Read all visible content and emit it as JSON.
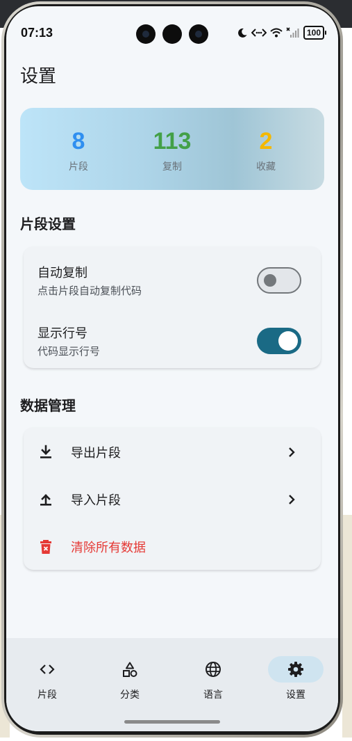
{
  "status_bar": {
    "time": "07:13",
    "battery": "100"
  },
  "page": {
    "title": "设置"
  },
  "stats": [
    {
      "value": "8",
      "label": "片段",
      "color": "#2f8ff0"
    },
    {
      "value": "113",
      "label": "复制",
      "color": "#43a047"
    },
    {
      "value": "2",
      "label": "收藏",
      "color": "#f5b800"
    }
  ],
  "snippet_settings": {
    "title": "片段设置",
    "items": [
      {
        "title": "自动复制",
        "desc": "点击片段自动复制代码",
        "enabled": false
      },
      {
        "title": "显示行号",
        "desc": "代码显示行号",
        "enabled": true
      }
    ]
  },
  "data_management": {
    "title": "数据管理",
    "items": [
      {
        "label": "导出片段",
        "icon": "download-icon"
      },
      {
        "label": "导入片段",
        "icon": "upload-icon"
      },
      {
        "label": "清除所有数据",
        "icon": "trash-icon",
        "color": "#e53935"
      }
    ]
  },
  "bottom_nav": {
    "items": [
      {
        "label": "片段",
        "icon": "code-icon"
      },
      {
        "label": "分类",
        "icon": "shapes-icon"
      },
      {
        "label": "语言",
        "icon": "globe-icon"
      },
      {
        "label": "设置",
        "icon": "gear-icon",
        "active": true
      }
    ]
  }
}
